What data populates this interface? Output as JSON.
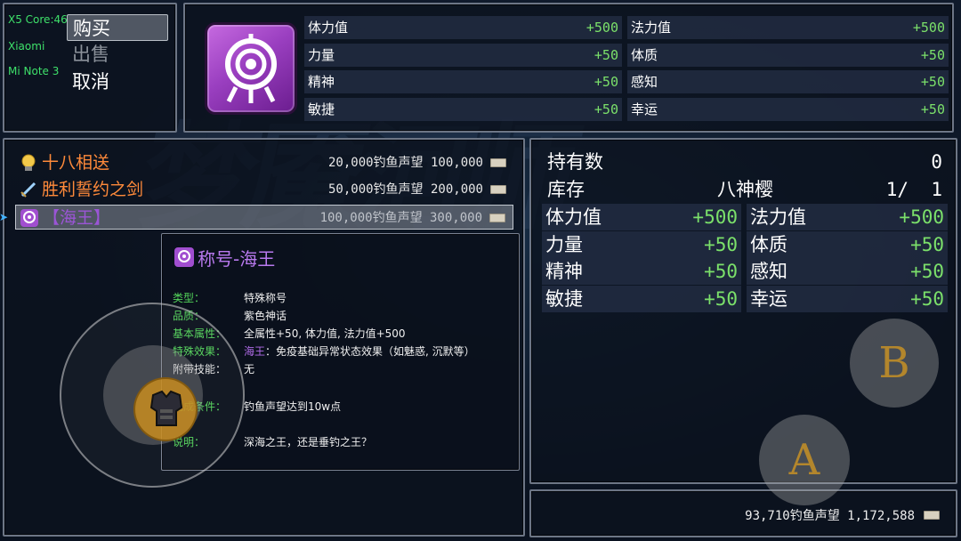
{
  "device": {
    "line1": "X5 Core:46",
    "line2": "Xiaomi",
    "line3": "Mi Note 3"
  },
  "commands": [
    {
      "label": "购买",
      "selected": true
    },
    {
      "label": "出售",
      "selected": false
    },
    {
      "label": "取消",
      "selected": false
    }
  ],
  "top_params": [
    {
      "key": "体力值",
      "value": "+500"
    },
    {
      "key": "法力值",
      "value": "+500"
    },
    {
      "key": "力量",
      "value": "+50"
    },
    {
      "key": "体质",
      "value": "+50"
    },
    {
      "key": "精神",
      "value": "+50"
    },
    {
      "key": "感知",
      "value": "+50"
    },
    {
      "key": "敏捷",
      "value": "+50"
    },
    {
      "key": "幸运",
      "value": "+50"
    }
  ],
  "shop_items": [
    {
      "name": "十八相送",
      "price": "20,000钓鱼声望 100,000",
      "name_color": "#ff8a3a",
      "icon": "lightbulb-icon"
    },
    {
      "name": "胜利誓约之剑",
      "price": "50,000钓鱼声望 200,000",
      "name_color": "#ff8a3a",
      "icon": "sword-icon"
    },
    {
      "name": "【海王】",
      "price": "100,000钓鱼声望 300,000",
      "name_color": "#9b55d6",
      "icon": "target-icon",
      "selected": true
    }
  ],
  "detail": {
    "title": "称号-海王",
    "rows": [
      {
        "label": "类型：",
        "value": "特殊称号"
      },
      {
        "label": "品质：",
        "value": "紫色神话"
      },
      {
        "label": "基本属性：",
        "value": "全属性+50, 体力值, 法力值+500"
      },
      {
        "label": "特殊效果：",
        "value_highlight": "海王",
        "value": "：免疫基础异常状态效果（如魅惑, 沉默等）"
      },
      {
        "label": "附带技能：",
        "value": "无"
      },
      {
        "label": "完成条件：",
        "value": "钓鱼声望达到10w点"
      },
      {
        "label": "说明：",
        "value": "深海之王，还是垂钓之王？"
      }
    ]
  },
  "status": {
    "owned_label": "持有数",
    "owned_value": "0",
    "stock_label": "库存",
    "stock_name": "八神樱",
    "stock_value": "1/  1",
    "params": [
      {
        "key": "体力值",
        "value": "+500"
      },
      {
        "key": "法力值",
        "value": "+500"
      },
      {
        "key": "力量",
        "value": "+50"
      },
      {
        "key": "体质",
        "value": "+50"
      },
      {
        "key": "精神",
        "value": "+50"
      },
      {
        "key": "感知",
        "value": "+50"
      },
      {
        "key": "敏捷",
        "value": "+50"
      },
      {
        "key": "幸运",
        "value": "+50"
      }
    ]
  },
  "gold": {
    "text": "93,710钓鱼声望 1,172,588"
  },
  "touch_buttons": {
    "a": "A",
    "b": "B"
  },
  "colors": {
    "accent_green": "#7be06a",
    "item_orange": "#ff8a3a",
    "item_purple": "#9b55d6"
  }
}
